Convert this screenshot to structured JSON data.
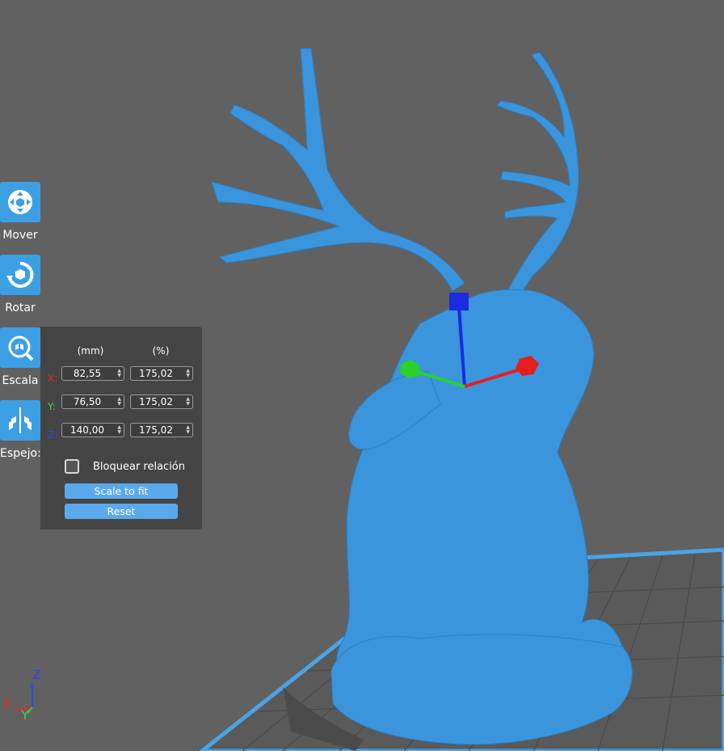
{
  "toolbar": {
    "tools": [
      {
        "id": "move",
        "label": "Mover",
        "icon": "move-icon"
      },
      {
        "id": "rotate",
        "label": "Rotar",
        "icon": "rotate-icon"
      },
      {
        "id": "scale",
        "label": "Escala",
        "icon": "scale-icon"
      },
      {
        "id": "mirror",
        "label": "Espejo:",
        "icon": "mirror-icon"
      }
    ]
  },
  "scale_panel": {
    "col_mm": "(mm)",
    "col_pct": "(%)",
    "rows": [
      {
        "axis": "X:",
        "mm": "82,55",
        "pct": "175,02",
        "color": "#e52b2b"
      },
      {
        "axis": "Y:",
        "mm": "76,50",
        "pct": "175,02",
        "color": "#3fcf3f"
      },
      {
        "axis": "Z:",
        "mm": "140,00",
        "pct": "175,02",
        "color": "#2a4be8"
      }
    ],
    "lock_label": "Bloquear relación",
    "scale_to_fit_label": "Scale to fit",
    "reset_label": "Reset"
  },
  "axes_gizmo": {
    "x": "X",
    "y": "Y",
    "z": "Z"
  },
  "colors": {
    "accent": "#3d9fe3",
    "model": "#3a95dd",
    "background": "#616161",
    "panel": "#454545"
  }
}
